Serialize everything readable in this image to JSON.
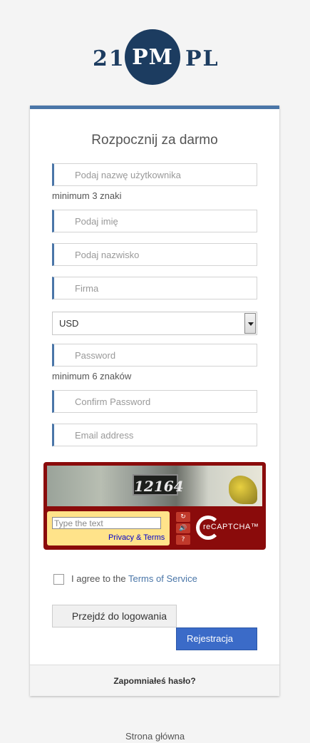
{
  "logo": {
    "left": "21",
    "center": "PM",
    "right": "PL"
  },
  "form": {
    "title": "Rozpocznij za darmo",
    "username_placeholder": "Podaj nazwę użytkownika",
    "username_hint": "minimum 3 znaki",
    "firstname_placeholder": "Podaj imię",
    "lastname_placeholder": "Podaj nazwisko",
    "company_placeholder": "Firma",
    "currency_selected": "USD",
    "password_placeholder": "Password",
    "password_hint": "minimum 6 znaków",
    "confirm_placeholder": "Confirm Password",
    "email_placeholder": "Email address"
  },
  "captcha": {
    "image_text": "12164",
    "input_placeholder": "Type the text",
    "privacy_link": "Privacy & Terms",
    "refresh_icon": "↻",
    "audio_icon": "🔊",
    "help_icon": "?",
    "brand": "reCAPTCHA™"
  },
  "agree": {
    "prefix": "I agree to the ",
    "link": "Terms of Service"
  },
  "buttons": {
    "login": "Przejdź do logowania",
    "register": "Rejestracja"
  },
  "footer": {
    "forgot": "Zapomniałeś hasło?"
  },
  "home_link": "Strona główna"
}
